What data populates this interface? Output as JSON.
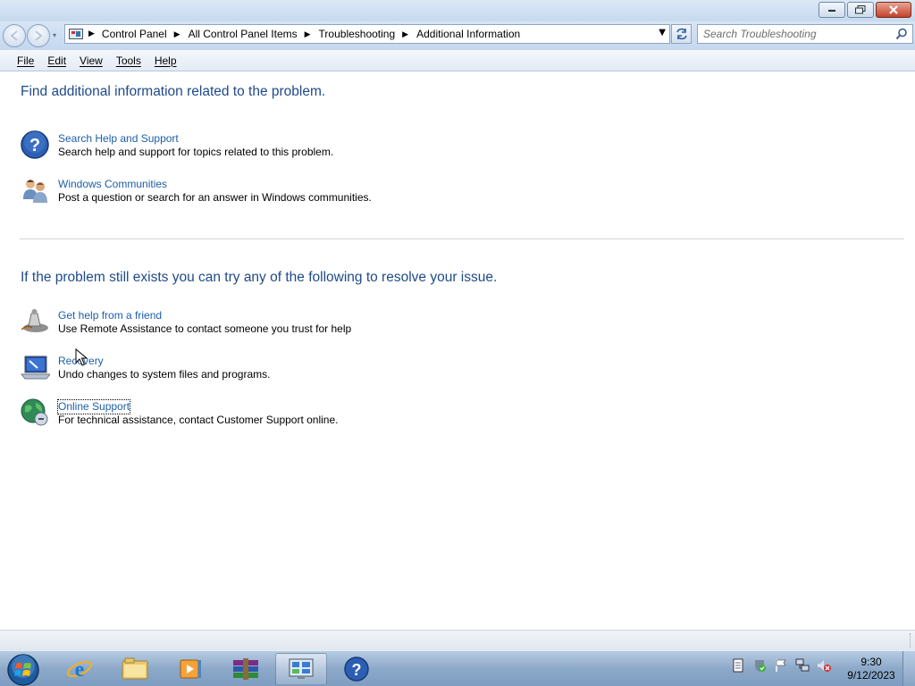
{
  "window": {
    "nav_dropdown_glyph": "▾"
  },
  "address_bar": {
    "breadcrumbs": [
      "Control Panel",
      "All Control Panel Items",
      "Troubleshooting",
      "Additional Information"
    ]
  },
  "search": {
    "placeholder": "Search Troubleshooting"
  },
  "menu": {
    "items": [
      "File",
      "Edit",
      "View",
      "Tools",
      "Help"
    ]
  },
  "content": {
    "heading1": "Find additional information related to the problem.",
    "section1": [
      {
        "icon": "help-support-icon",
        "link": "Search Help and Support",
        "desc": "Search help and support for topics related to this problem."
      },
      {
        "icon": "windows-communities-icon",
        "link": "Windows Communities",
        "desc": "Post a question or search for an answer in Windows communities."
      }
    ],
    "heading2": "If the problem still exists you can try any of the following to resolve your issue.",
    "section2": [
      {
        "icon": "remote-assistance-icon",
        "link": "Get help from a friend",
        "desc": "Use Remote Assistance to contact someone you trust for help"
      },
      {
        "icon": "recovery-icon",
        "link": "Recovery",
        "desc": "Undo changes to system files and programs."
      },
      {
        "icon": "online-support-icon",
        "link": "Online Support",
        "desc": "For technical assistance, contact Customer Support online."
      }
    ]
  },
  "taskbar": {
    "apps": [
      "internet-explorer-icon",
      "windows-explorer-icon",
      "media-player-icon",
      "winrar-icon",
      "control-panel-icon",
      "help-icon"
    ],
    "clock_time": "9:30",
    "clock_date": "9/12/2023"
  },
  "colors": {
    "heading": "#1f4a8a",
    "link": "#1b5fa8"
  }
}
